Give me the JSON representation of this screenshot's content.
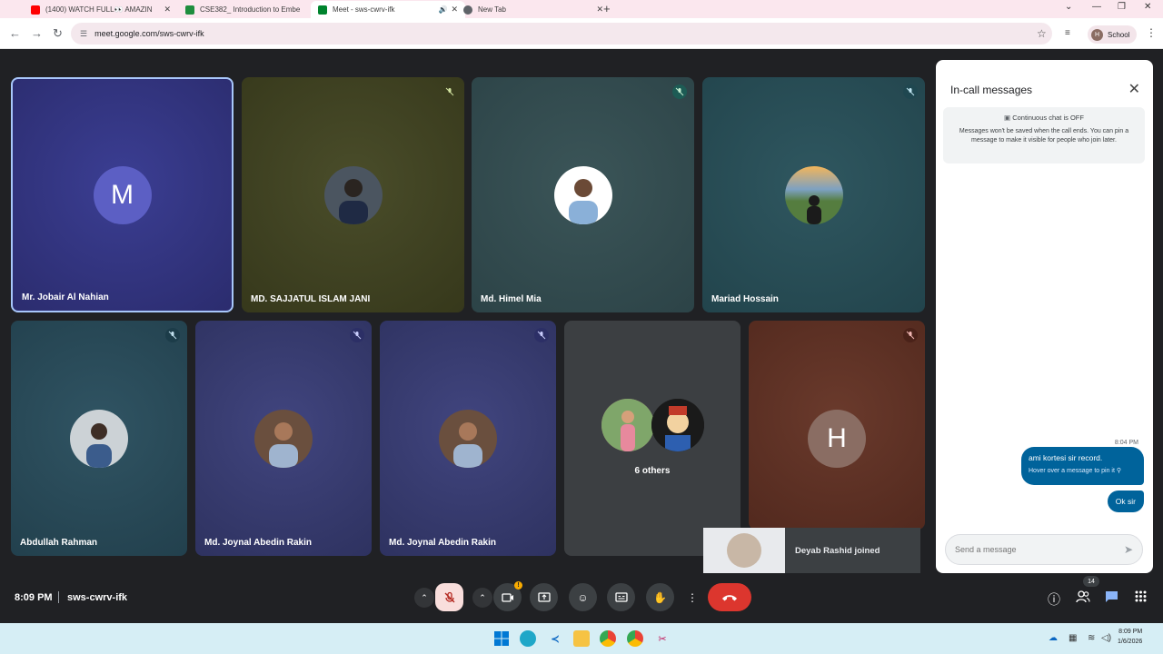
{
  "browser": {
    "tabs": [
      {
        "title": "(1400) WATCH FULL👀 AMAZIN",
        "icon": "youtube-icon",
        "color": "#ff0000"
      },
      {
        "title": "CSE382_ Introduction to Embe",
        "icon": "classroom-icon",
        "color": "#1e8e3e"
      },
      {
        "title": "Meet - sws-cwrv-ifk",
        "icon": "meet-icon",
        "color": "#00832d"
      },
      {
        "title": "New Tab",
        "icon": "chrome-icon",
        "color": "#5f6368"
      }
    ],
    "url": "meet.google.com/sws-cwrv-ifk",
    "profile_initial": "H",
    "profile_label": "School"
  },
  "participants": [
    {
      "name": "Mr. Jobair Al Nahian",
      "initial": "M",
      "bg": "#35367f",
      "avatar_bg": "#5c5fc4"
    },
    {
      "name": "MD. SAJJATUL ISLAM JANI",
      "bg": "#3f4220",
      "avatar_bg": "#4b5560"
    },
    {
      "name": "Md. Himel Mia",
      "bg": "#344b4e",
      "avatar_bg": "#dfe3ea"
    },
    {
      "name": "Mariad Hossain",
      "bg": "#264c55",
      "avatar_bg": "#6f8f66"
    },
    {
      "name": "Abdullah Rahman",
      "bg": "#254552",
      "avatar_bg": "#ccd2d6"
    },
    {
      "name": "Md. Joynal Abedin Rakin",
      "bg": "#343a70",
      "avatar_bg": "#6a4f3e"
    },
    {
      "name": "Md. Joynal Abedin Rakin",
      "bg": "#343a70",
      "avatar_bg": "#6a4f3e"
    },
    {
      "name": "6 others",
      "bg": "#3c3f42"
    },
    {
      "name": "",
      "initial": "H",
      "bg": "#5a2e22",
      "avatar_bg": "#8a6d63"
    }
  ],
  "chat": {
    "title": "In-call messages",
    "notice_heading": "Continuous chat is OFF",
    "notice_body": "Messages won't be saved when the call ends. You can pin a message to make it visible for people who join later.",
    "time": "8:04 PM",
    "messages": [
      {
        "text": "ami kortesi sir record.",
        "hint": "Hover over a message to pin it"
      },
      {
        "text": "Ok sir"
      }
    ],
    "input_placeholder": "Send a message"
  },
  "toast": {
    "text": "Deyab Rashid joined"
  },
  "bottom": {
    "time": "8:09 PM",
    "meeting_code": "sws-cwrv-ifk",
    "people_count": "14"
  },
  "taskbar": {
    "time": "8:09 PM",
    "date": "1/6/2026"
  }
}
